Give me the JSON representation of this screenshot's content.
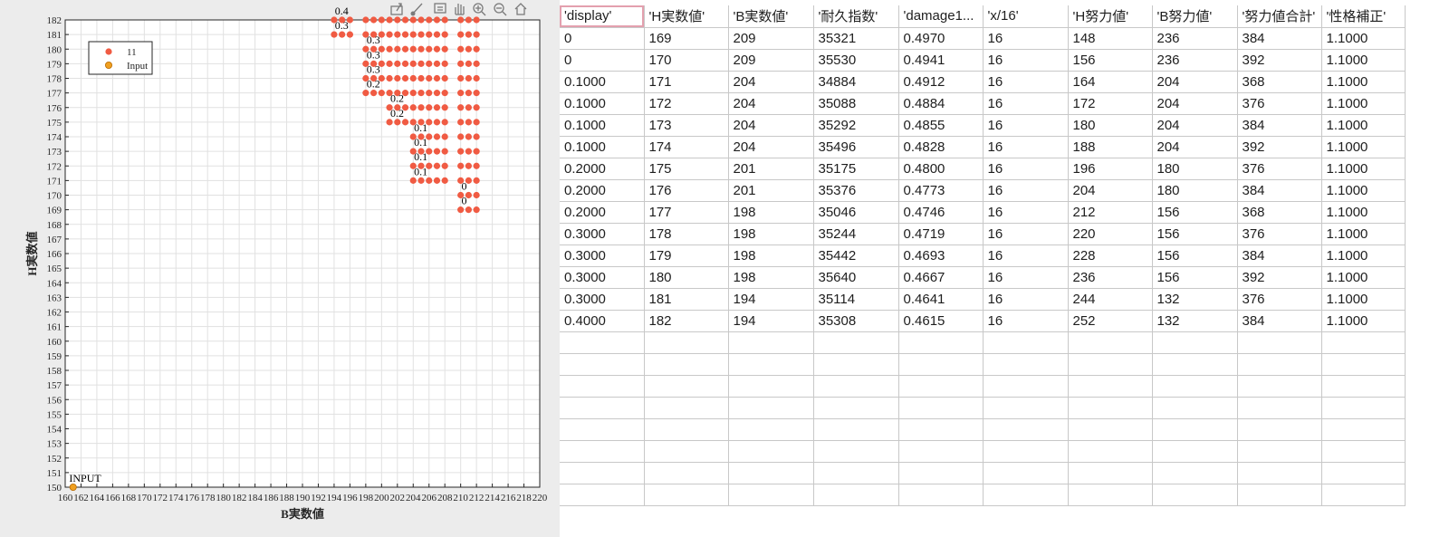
{
  "plot": {
    "xlabel": "B実数値",
    "ylabel": "H実数値",
    "xlim": [
      160,
      220
    ],
    "ylim": [
      150,
      182
    ],
    "xticks": [
      160,
      162,
      164,
      166,
      168,
      170,
      172,
      174,
      176,
      178,
      180,
      182,
      184,
      186,
      188,
      190,
      192,
      194,
      196,
      198,
      200,
      202,
      204,
      206,
      208,
      210,
      212,
      214,
      216,
      218,
      220
    ],
    "yticks": [
      150,
      151,
      152,
      153,
      154,
      155,
      156,
      157,
      158,
      159,
      160,
      161,
      162,
      163,
      164,
      165,
      166,
      167,
      168,
      169,
      170,
      171,
      172,
      173,
      174,
      175,
      176,
      177,
      178,
      179,
      180,
      181,
      182
    ],
    "grid": true,
    "legend": {
      "placement": "top-left",
      "entries": [
        "11",
        "Input"
      ]
    },
    "colors": {
      "series11": "#f05b43",
      "input": "#f0a020",
      "input_edge": "#b86a00"
    },
    "toolbar_icons": [
      "export-icon",
      "brush-icon",
      "data-tips-icon",
      "pan-icon",
      "zoom-in-icon",
      "zoom-out-icon",
      "home-icon"
    ]
  },
  "chart_data": {
    "type": "scatter",
    "title": "",
    "xlabel": "B実数値",
    "ylabel": "H実数値",
    "xlim": [
      160,
      220
    ],
    "ylim": [
      150,
      182
    ],
    "series": [
      {
        "name": "11",
        "rows": [
          {
            "y": 182,
            "x": [
              194,
              195,
              196,
              198,
              199,
              200,
              201,
              202,
              203,
              204,
              205,
              206,
              207,
              208,
              210,
              211,
              212
            ]
          },
          {
            "y": 181,
            "x": [
              194,
              195,
              196,
              198,
              199,
              200,
              201,
              202,
              203,
              204,
              205,
              206,
              207,
              208,
              210,
              211,
              212
            ]
          },
          {
            "y": 180,
            "x": [
              198,
              199,
              200,
              201,
              202,
              203,
              204,
              205,
              206,
              207,
              208,
              210,
              211,
              212
            ]
          },
          {
            "y": 179,
            "x": [
              198,
              199,
              200,
              201,
              202,
              203,
              204,
              205,
              206,
              207,
              208,
              210,
              211,
              212
            ]
          },
          {
            "y": 178,
            "x": [
              198,
              199,
              200,
              201,
              202,
              203,
              204,
              205,
              206,
              207,
              208,
              210,
              211,
              212
            ]
          },
          {
            "y": 177,
            "x": [
              198,
              199,
              200,
              201,
              202,
              203,
              204,
              205,
              206,
              207,
              208,
              210,
              211,
              212
            ]
          },
          {
            "y": 176,
            "x": [
              201,
              202,
              203,
              204,
              205,
              206,
              207,
              208,
              210,
              211,
              212
            ]
          },
          {
            "y": 175,
            "x": [
              201,
              202,
              203,
              204,
              205,
              206,
              207,
              208,
              210,
              211,
              212
            ]
          },
          {
            "y": 174,
            "x": [
              204,
              205,
              206,
              207,
              208,
              210,
              211,
              212
            ]
          },
          {
            "y": 173,
            "x": [
              204,
              205,
              206,
              207,
              208,
              210,
              211,
              212
            ]
          },
          {
            "y": 172,
            "x": [
              204,
              205,
              206,
              207,
              208,
              210,
              211,
              212
            ]
          },
          {
            "y": 171,
            "x": [
              204,
              205,
              206,
              207,
              208,
              210,
              211,
              212
            ]
          },
          {
            "y": 170,
            "x": [
              210,
              211,
              212
            ]
          },
          {
            "y": 169,
            "x": [
              210,
              211,
              212
            ]
          }
        ]
      },
      {
        "name": "Input",
        "rows": [
          {
            "y": 150,
            "x": [
              161
            ]
          }
        ]
      }
    ],
    "annotations": [
      {
        "x": 194.1,
        "y": 182.5,
        "text": "0.4"
      },
      {
        "x": 194.1,
        "y": 181.5,
        "text": "0.3"
      },
      {
        "x": 198.1,
        "y": 180.5,
        "text": "0.3"
      },
      {
        "x": 198.1,
        "y": 179.5,
        "text": "0.3"
      },
      {
        "x": 198.1,
        "y": 178.5,
        "text": "0.3"
      },
      {
        "x": 198.1,
        "y": 177.5,
        "text": "0.2"
      },
      {
        "x": 201.1,
        "y": 176.5,
        "text": "0.2"
      },
      {
        "x": 201.1,
        "y": 175.5,
        "text": "0.2"
      },
      {
        "x": 204.1,
        "y": 174.5,
        "text": "0.1"
      },
      {
        "x": 204.1,
        "y": 173.5,
        "text": "0.1"
      },
      {
        "x": 204.1,
        "y": 172.5,
        "text": "0.1"
      },
      {
        "x": 204.1,
        "y": 171.5,
        "text": "0.1"
      },
      {
        "x": 210.1,
        "y": 170.5,
        "text": "0"
      },
      {
        "x": 210.1,
        "y": 169.5,
        "text": "0"
      },
      {
        "x": 160.5,
        "y": 150.5,
        "text": "INPUT"
      }
    ]
  },
  "table": {
    "columns": [
      "'display'",
      "'H実数値'",
      "'B実数値'",
      "'耐久指数'",
      "'damage1...",
      "'x/16'",
      "'H努力値'",
      "'B努力値'",
      "'努力値合計'",
      "'性格補正'"
    ],
    "rows": [
      [
        "0",
        "169",
        "209",
        "35321",
        "0.4970",
        "16",
        "148",
        "236",
        "384",
        "1.1000"
      ],
      [
        "0",
        "170",
        "209",
        "35530",
        "0.4941",
        "16",
        "156",
        "236",
        "392",
        "1.1000"
      ],
      [
        "0.1000",
        "171",
        "204",
        "34884",
        "0.4912",
        "16",
        "164",
        "204",
        "368",
        "1.1000"
      ],
      [
        "0.1000",
        "172",
        "204",
        "35088",
        "0.4884",
        "16",
        "172",
        "204",
        "376",
        "1.1000"
      ],
      [
        "0.1000",
        "173",
        "204",
        "35292",
        "0.4855",
        "16",
        "180",
        "204",
        "384",
        "1.1000"
      ],
      [
        "0.1000",
        "174",
        "204",
        "35496",
        "0.4828",
        "16",
        "188",
        "204",
        "392",
        "1.1000"
      ],
      [
        "0.2000",
        "175",
        "201",
        "35175",
        "0.4800",
        "16",
        "196",
        "180",
        "376",
        "1.1000"
      ],
      [
        "0.2000",
        "176",
        "201",
        "35376",
        "0.4773",
        "16",
        "204",
        "180",
        "384",
        "1.1000"
      ],
      [
        "0.2000",
        "177",
        "198",
        "35046",
        "0.4746",
        "16",
        "212",
        "156",
        "368",
        "1.1000"
      ],
      [
        "0.3000",
        "178",
        "198",
        "35244",
        "0.4719",
        "16",
        "220",
        "156",
        "376",
        "1.1000"
      ],
      [
        "0.3000",
        "179",
        "198",
        "35442",
        "0.4693",
        "16",
        "228",
        "156",
        "384",
        "1.1000"
      ],
      [
        "0.3000",
        "180",
        "198",
        "35640",
        "0.4667",
        "16",
        "236",
        "156",
        "392",
        "1.1000"
      ],
      [
        "0.3000",
        "181",
        "194",
        "35114",
        "0.4641",
        "16",
        "244",
        "132",
        "376",
        "1.1000"
      ],
      [
        "0.4000",
        "182",
        "194",
        "35308",
        "0.4615",
        "16",
        "252",
        "132",
        "384",
        "1.1000"
      ]
    ],
    "empty_rows": 8
  }
}
